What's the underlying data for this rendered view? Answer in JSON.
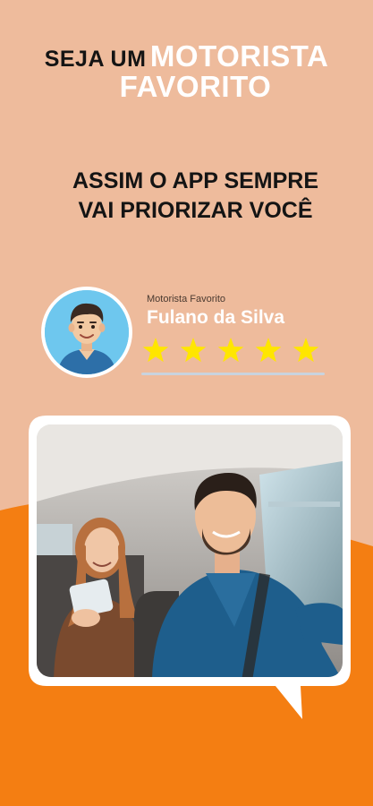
{
  "colors": {
    "background": "#EEBB9C",
    "accent_orange": "#F47E12",
    "star": "#FFE600",
    "avatar_bg": "#6EC7EE"
  },
  "headline": {
    "prefix": "SEJA UM",
    "highlight_line1": "MOTORISTA",
    "highlight_line2": "FAVORITO"
  },
  "subheadline": {
    "line1": "ASSIM O APP SEMPRE",
    "line2": "VAI PRIORIZAR VOCÊ"
  },
  "driver_card": {
    "label": "Motorista Favorito",
    "name": "Fulano da Silva",
    "rating": 5,
    "rating_max": 5,
    "avatar_icon": "driver-avatar-icon"
  },
  "photo": {
    "icon": "driver-passenger-photo"
  }
}
